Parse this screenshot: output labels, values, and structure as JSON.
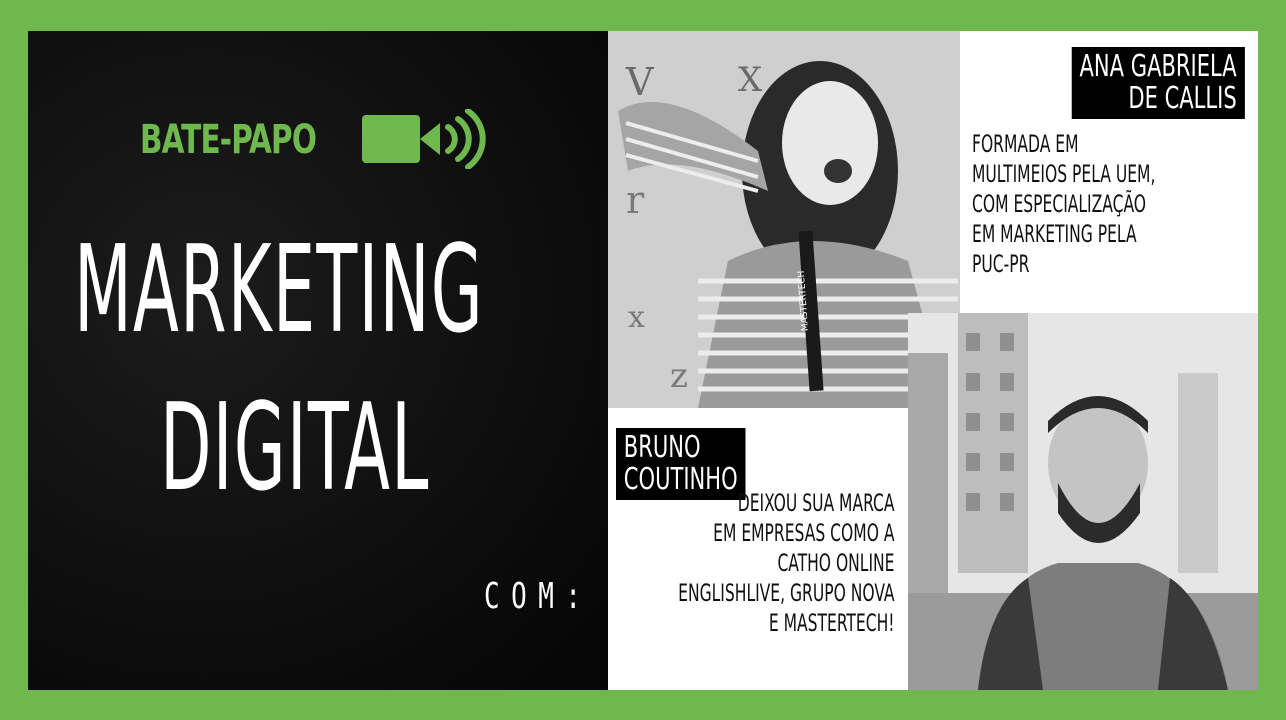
{
  "header": {
    "tag": "BATE-PAPO",
    "camera_icon": "video-camera-icon"
  },
  "title": {
    "line1": "MARKETING",
    "line2": "DIGITAL"
  },
  "com": "COM:",
  "speaker1": {
    "name_line1": "ANA GABRIELA",
    "name_line2": "DE CALLIS",
    "bio": [
      "FORMADA EM",
      "MULTIMEIOS PELA UEM,",
      "COM ESPECIALIZAÇÃO",
      "EM MARKETING PELA",
      "PUC-PR"
    ],
    "photo_text": {
      "badge": "MASTERTECH"
    }
  },
  "speaker2": {
    "name_line1": "BRUNO",
    "name_line2": "COUTINHO",
    "bio": [
      "DEIXOU SUA MARCA",
      "EM EMPRESAS COMO A",
      "CATHO ONLINE",
      "ENGLISHLIVE, GRUPO NOVA",
      "E MASTERTECH!"
    ]
  },
  "colors": {
    "frame": "#6fb84e",
    "accent": "#6fb84e",
    "dark": "#0b0b0b",
    "white": "#ffffff"
  }
}
